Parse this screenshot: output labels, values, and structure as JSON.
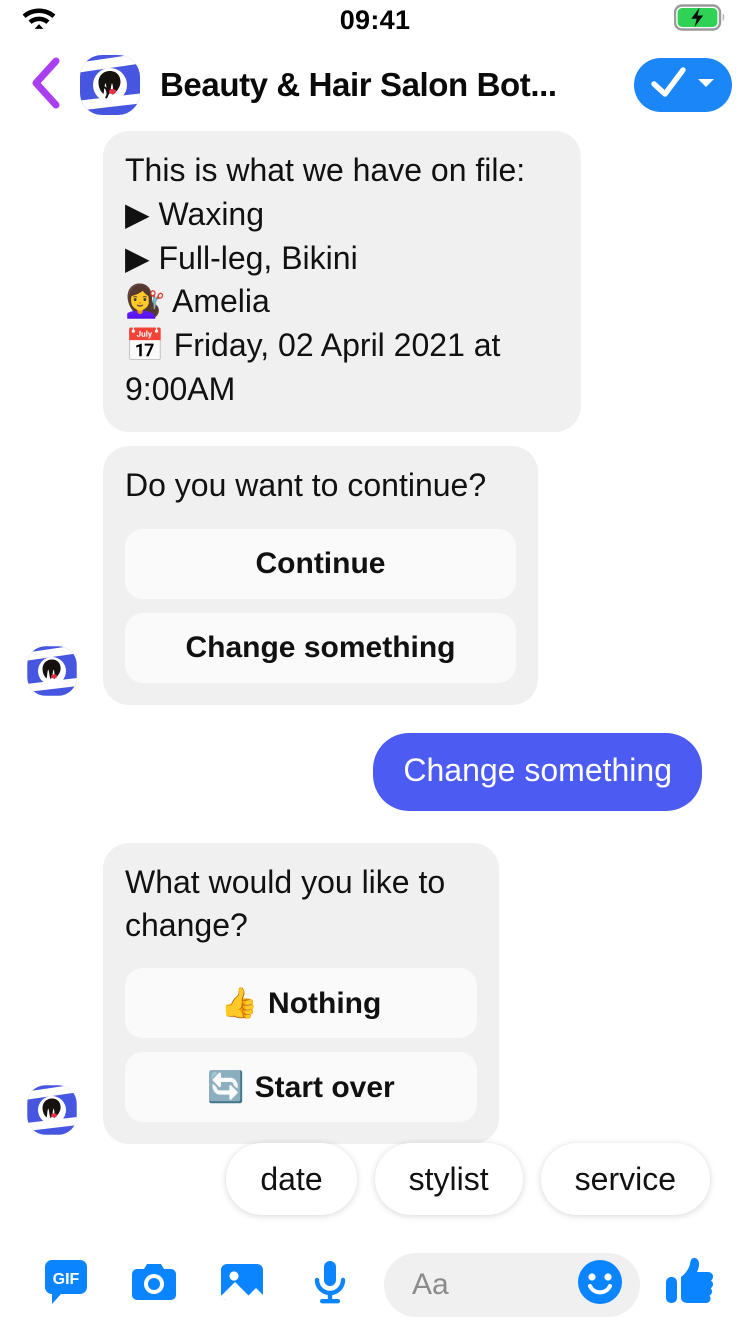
{
  "status_bar": {
    "time": "09:41",
    "wifi_icon": "wifi-icon",
    "battery_icon": "battery-charging-icon"
  },
  "header": {
    "back_icon": "back-chevron-icon",
    "avatar_icon": "salon-bot-avatar",
    "title": "Beauty & Hair Salon Bot...",
    "action_icon": "checkmark-dropdown-icon",
    "action_color": "#1b86f7"
  },
  "colors": {
    "bot_bubble": "#f0f0f0",
    "user_bubble": "#4c5bf2",
    "card_button": "#fafafa",
    "accent_blue": "#1b86f7",
    "back_chevron": "#a93ff0"
  },
  "thread": {
    "messages": [
      {
        "sender": "bot",
        "type": "text",
        "lines": [
          "This is what we have on file:",
          "▶ Waxing",
          "▶ Full-leg, Bikini",
          "💇‍♀️ Amelia",
          "📅 Friday, 02 April 2021 at 9:00AM"
        ]
      },
      {
        "sender": "bot",
        "type": "card",
        "text": "Do you want to continue?",
        "buttons": [
          {
            "label": "Continue",
            "emoji": ""
          },
          {
            "label": "Change something",
            "emoji": ""
          }
        ]
      },
      {
        "sender": "user",
        "type": "text",
        "text": "Change something"
      },
      {
        "sender": "bot",
        "type": "card",
        "text": "What would you like to change?",
        "buttons": [
          {
            "label": "Nothing",
            "emoji": "👍"
          },
          {
            "label": "Start over",
            "emoji": "🔄"
          }
        ]
      }
    ]
  },
  "quick_replies": [
    {
      "label": "date"
    },
    {
      "label": "stylist"
    },
    {
      "label": "service"
    }
  ],
  "composer": {
    "tools": [
      {
        "name": "gif-icon",
        "label": "GIF"
      },
      {
        "name": "camera-icon",
        "label": ""
      },
      {
        "name": "photo-icon",
        "label": ""
      },
      {
        "name": "microphone-icon",
        "label": ""
      }
    ],
    "input_placeholder": "Aa",
    "emoji_icon": "smiley-icon",
    "thumbs_up_icon": "thumbs-up-icon"
  }
}
